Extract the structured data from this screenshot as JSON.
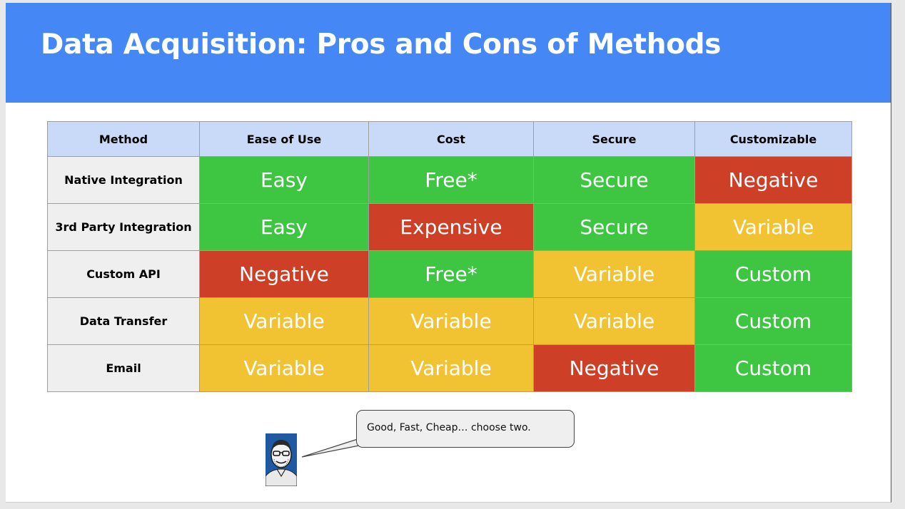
{
  "slide": {
    "title": "Data Acquisition: Pros and Cons of Methods"
  },
  "colors": {
    "title_bar": "#4587f4",
    "header_fill": "#c9daf8",
    "row_header_fill": "#efefef",
    "green": "#3ec542",
    "red": "#cd3f26",
    "yellow": "#f1c232"
  },
  "table": {
    "headers": [
      "Method",
      "Ease of Use",
      "Cost",
      "Secure",
      "Customizable"
    ],
    "rows": [
      {
        "method": "Native Integration",
        "cells": [
          {
            "text": "Easy",
            "rating": "green"
          },
          {
            "text": "Free*",
            "rating": "green"
          },
          {
            "text": "Secure",
            "rating": "green"
          },
          {
            "text": "Negative",
            "rating": "red"
          }
        ]
      },
      {
        "method": "3rd Party Integration",
        "cells": [
          {
            "text": "Easy",
            "rating": "green"
          },
          {
            "text": "Expensive",
            "rating": "red"
          },
          {
            "text": "Secure",
            "rating": "green"
          },
          {
            "text": "Variable",
            "rating": "yellow"
          }
        ]
      },
      {
        "method": "Custom API",
        "cells": [
          {
            "text": "Negative",
            "rating": "red"
          },
          {
            "text": "Free*",
            "rating": "green"
          },
          {
            "text": "Variable",
            "rating": "yellow"
          },
          {
            "text": "Custom",
            "rating": "green"
          }
        ]
      },
      {
        "method": "Data Transfer",
        "cells": [
          {
            "text": "Variable",
            "rating": "yellow"
          },
          {
            "text": "Variable",
            "rating": "yellow"
          },
          {
            "text": "Variable",
            "rating": "yellow"
          },
          {
            "text": "Custom",
            "rating": "green"
          }
        ]
      },
      {
        "method": "Email",
        "cells": [
          {
            "text": "Variable",
            "rating": "yellow"
          },
          {
            "text": "Variable",
            "rating": "yellow"
          },
          {
            "text": "Negative",
            "rating": "red"
          },
          {
            "text": "Custom",
            "rating": "green"
          }
        ]
      }
    ]
  },
  "callout": {
    "text": "Good, Fast, Cheap… choose two.",
    "avatar_icon": "presenter-avatar-icon"
  }
}
